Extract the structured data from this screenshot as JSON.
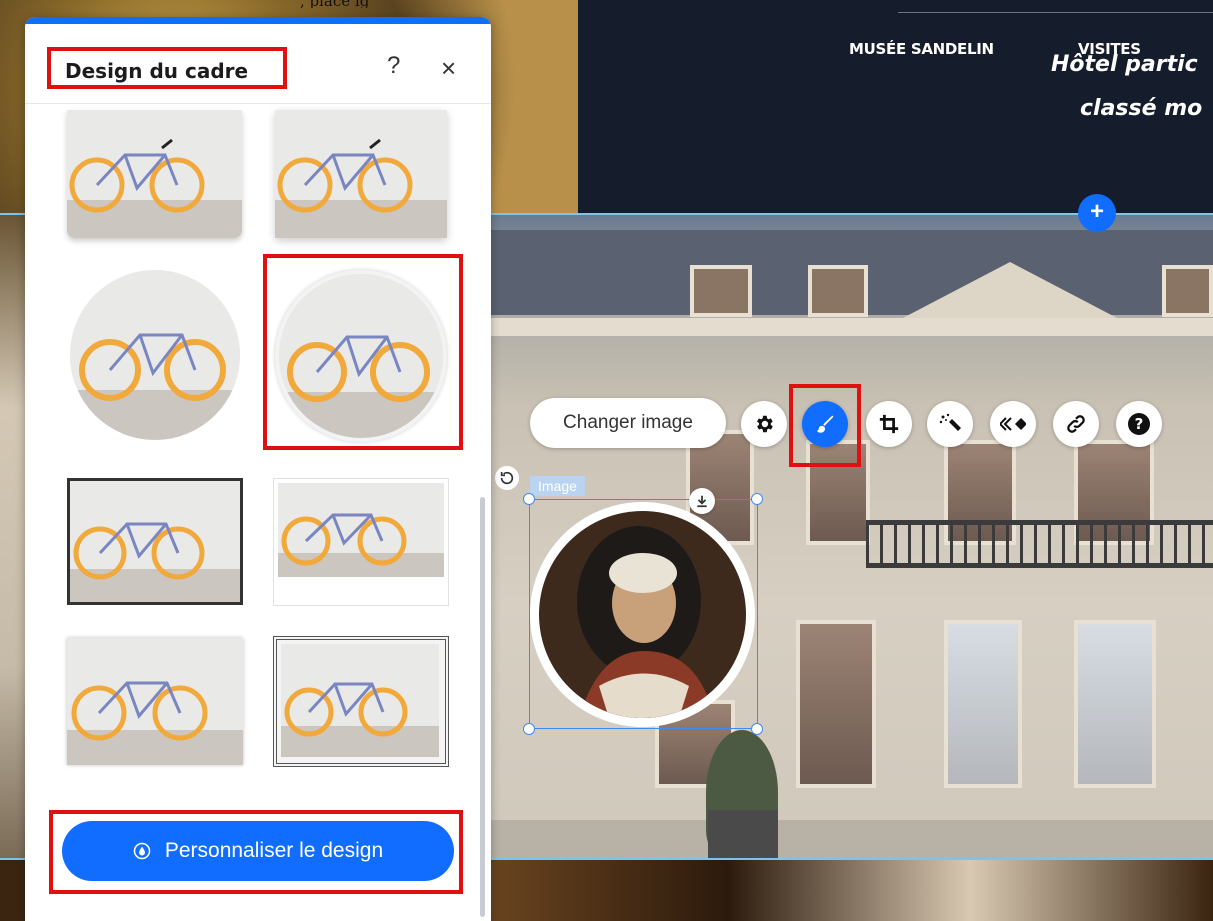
{
  "site": {
    "caption_partial": ", placé                 ig",
    "nav": [
      "MUSÉE SANDELIN",
      "VISITES"
    ],
    "hero_line1": "Hôtel partic",
    "hero_line2": "classé mo"
  },
  "panel": {
    "title": "Design du cadre",
    "help_label": "?",
    "close_label": "×",
    "customize_button": "Personnaliser le design"
  },
  "toolbar": {
    "change_image": "Changer image",
    "tools": [
      "gear-icon",
      "paintbrush-icon",
      "crop-icon",
      "magic-wand-icon",
      "animation-icon",
      "link-icon",
      "help-icon"
    ]
  },
  "selected_image": {
    "label": "Image"
  },
  "colors": {
    "accent": "#116dff",
    "highlight": "#e01010",
    "nav_bg": "#151c2b"
  }
}
